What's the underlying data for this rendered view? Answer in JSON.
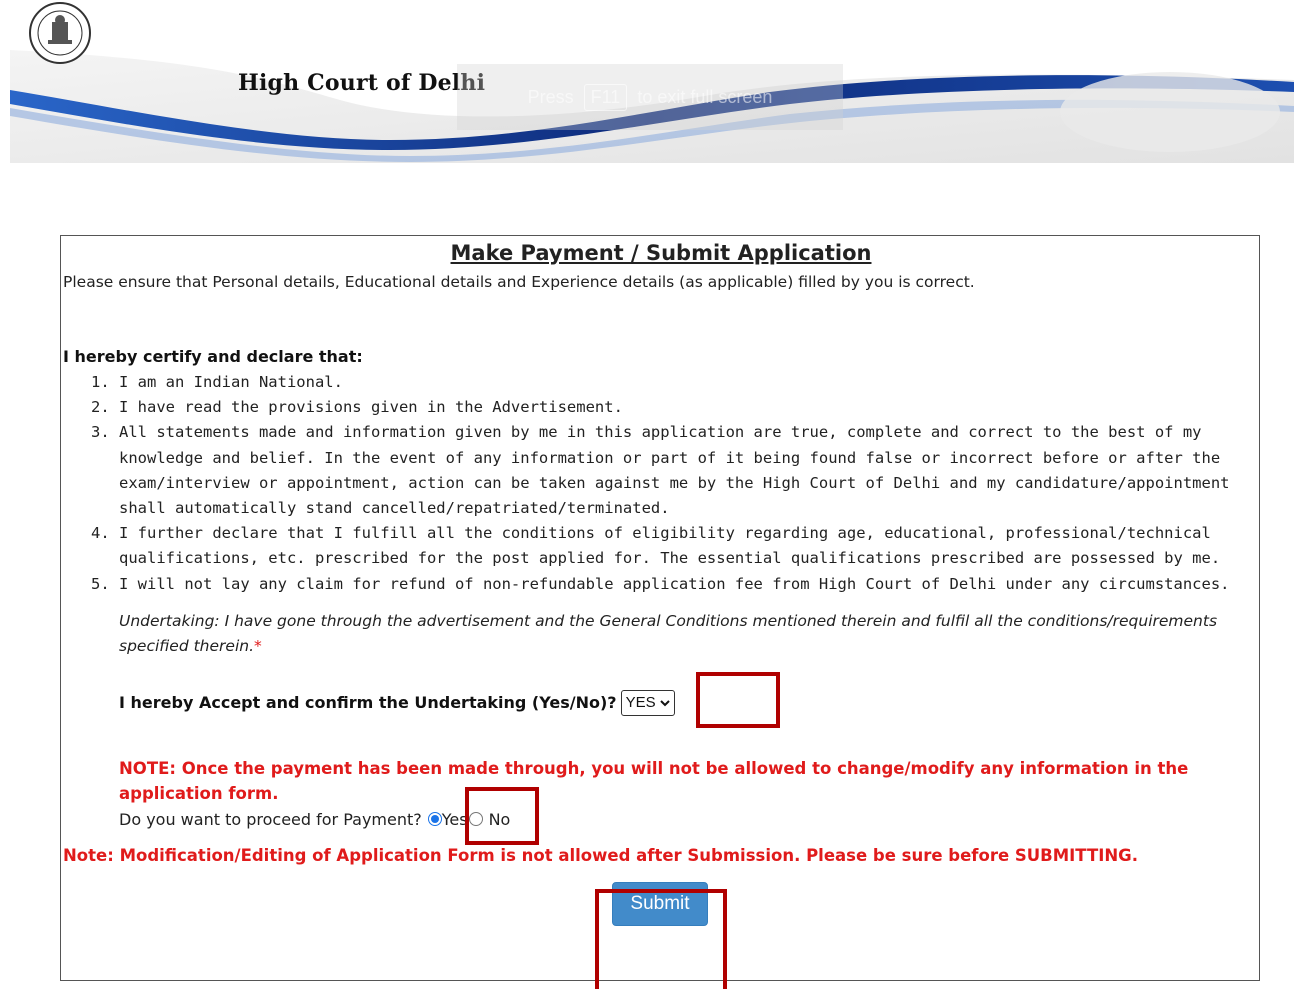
{
  "header": {
    "court_name": "High Court of Delhi",
    "emblem_text": "HIGH COURT OF DELHI",
    "fullscreen_hint": {
      "before": "Press",
      "key": "F11",
      "after": "to exit full screen"
    }
  },
  "form": {
    "title": "Make Payment / Submit Application",
    "intro": "Please ensure that Personal details, Educational details and Experience details (as applicable) filled by you is correct.",
    "certify_heading": "I hereby certify and declare that:",
    "declarations": [
      "I am an Indian National.",
      "I have read the provisions given in the Advertisement.",
      "All statements made and information given by me in this application are true, complete and correct to the best of my knowledge and belief. In the event of any information or part of it being found false or incorrect before or after the exam/interview or appointment, action can be taken against me by the High Court of Delhi and my candidature/appointment shall automatically stand cancelled/repatriated/terminated.",
      "I further declare that I fulfill all the conditions of eligibility regarding age, educational, professional/technical qualifications, etc. prescribed for the post applied for. The essential qualifications prescribed are possessed by me.",
      "I will not lay any claim for refund of non-refundable application fee from High Court of Delhi under any circumstances."
    ],
    "undertaking": "Undertaking: I have gone through the advertisement and the General Conditions mentioned therein and fulfil all the conditions/requirements specified therein.",
    "required_mark": "*",
    "accept_label": "I hereby Accept and confirm the Undertaking (Yes/No)?",
    "accept_value": "YES",
    "payment_note": "NOTE: Once the payment has been made through, you will not be allowed to change/modify any information in the application form.",
    "proceed_label": "Do you want to proceed for Payment?",
    "proceed_yes": "Yes",
    "proceed_no": "No",
    "proceed_selected": "Yes",
    "modification_note": "Note: Modification/Editing of Application Form is not allowed after Submission. Please be sure before SUBMITTING.",
    "submit_label": "Submit"
  },
  "colors": {
    "accent_red": "#e01b1b",
    "highlight_box": "#b00000",
    "submit_button": "#428bca",
    "banner_blue": "#1a3a8c"
  }
}
